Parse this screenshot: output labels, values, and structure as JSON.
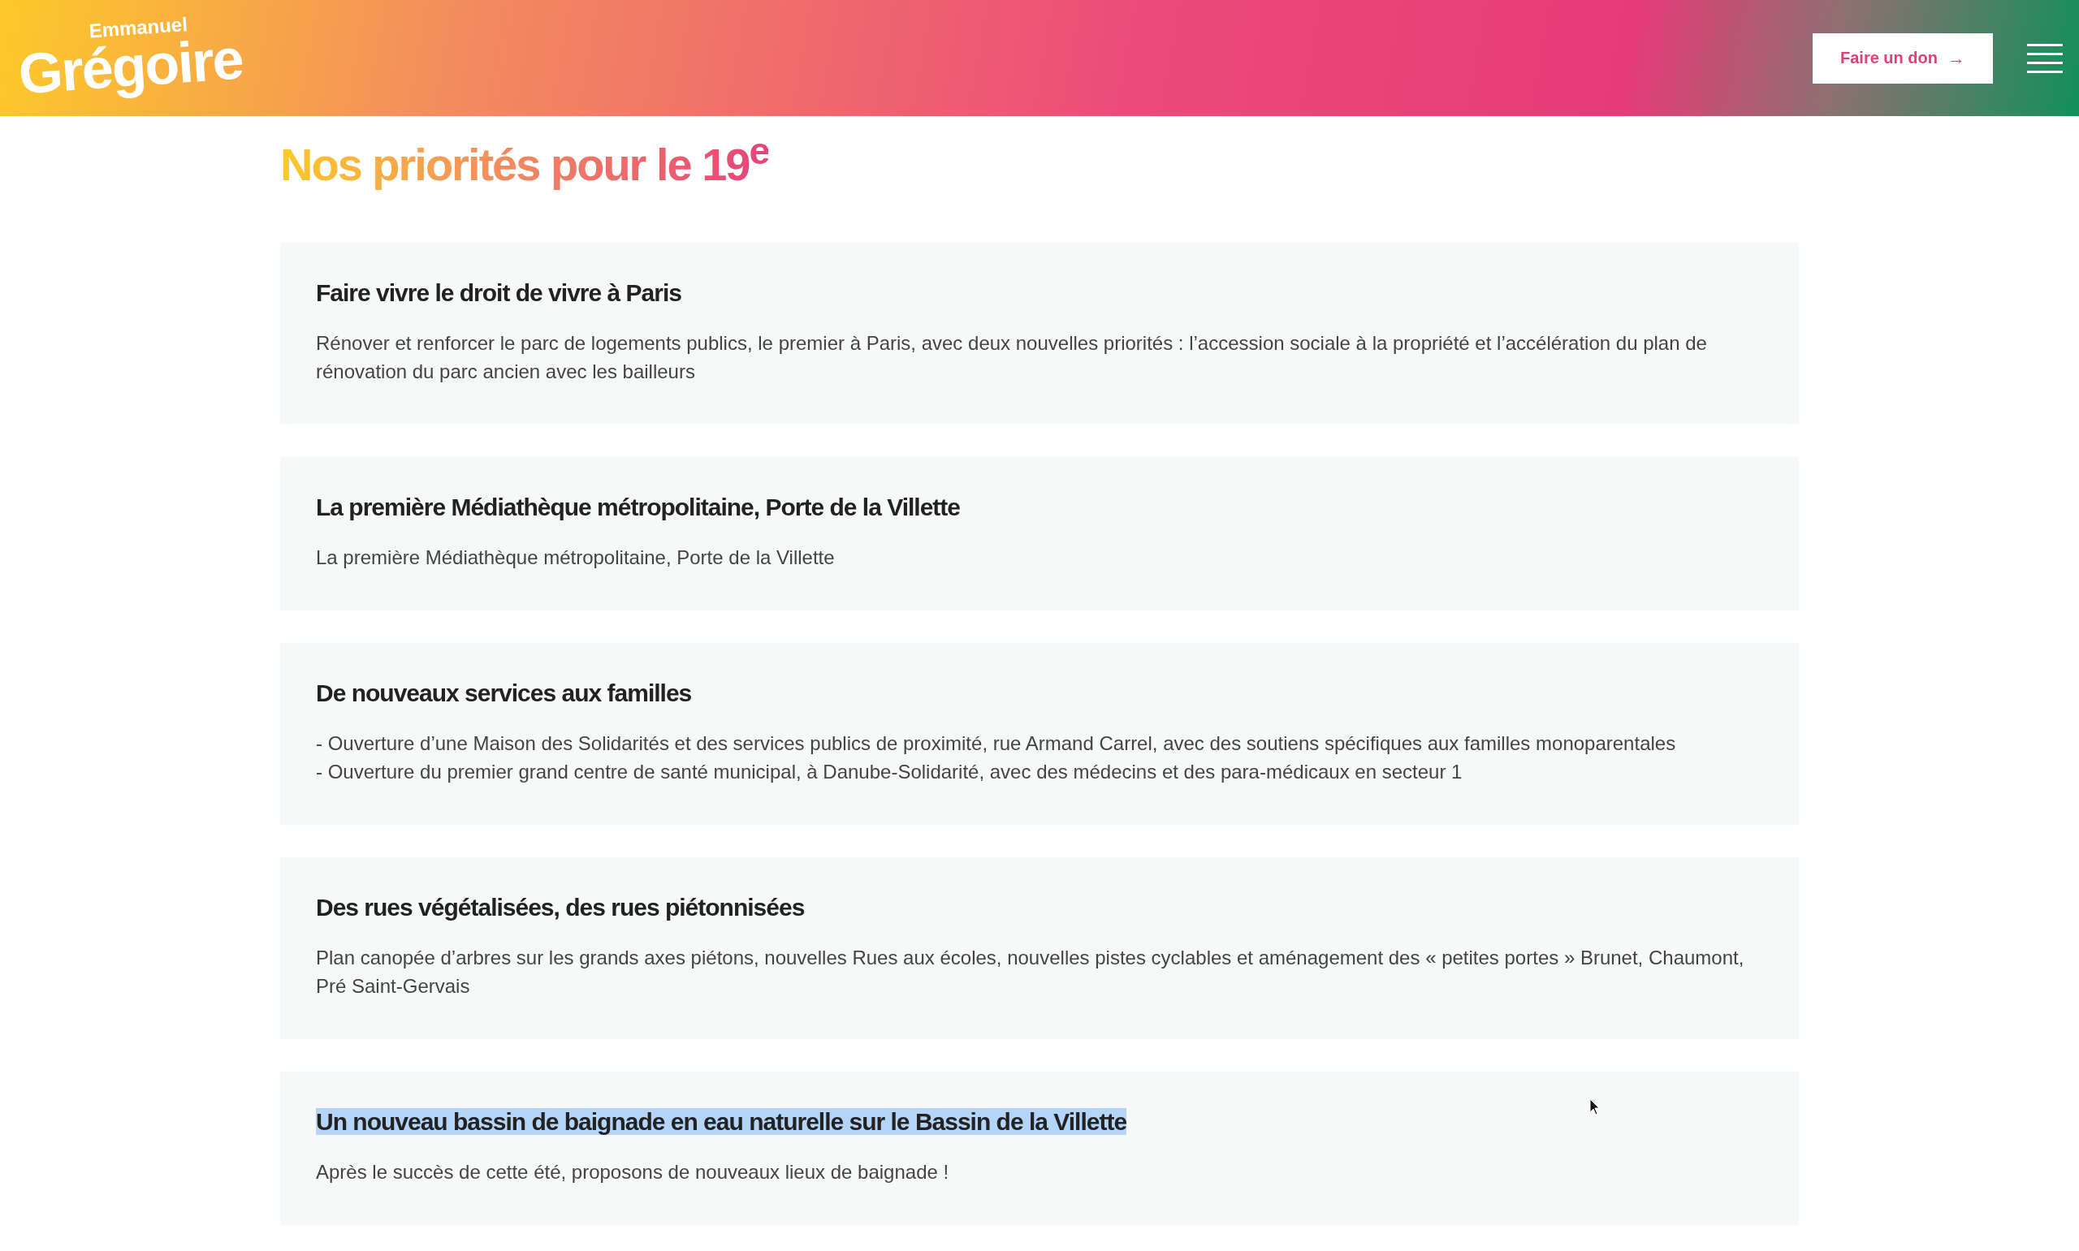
{
  "header": {
    "logo": {
      "first_name": "Emmanuel",
      "last_name": "Grégoire"
    },
    "donate_button": "Faire un don",
    "arrow": "→"
  },
  "page_title": "Nos priorités pour le 19$^{e}$",
  "priorities": [
    {
      "title": "Faire vivre le droit de vivre à Paris",
      "highlighted": false,
      "paragraphs": [
        "Rénover et renforcer le parc de logements publics, le premier à Paris, avec deux nouvelles priorités : l’accession sociale à la propriété et l’accélération du plan de rénovation du parc ancien avec les bailleurs"
      ]
    },
    {
      "title": "La première Médiathèque métropolitaine, Porte de la Villette",
      "highlighted": false,
      "paragraphs": [
        "La première Médiathèque métropolitaine, Porte de la Villette"
      ]
    },
    {
      "title": "De nouveaux services aux familles",
      "highlighted": false,
      "paragraphs": [
        "- Ouverture d’une Maison des Solidarités et des services publics de proximité, rue Armand Carrel, avec des soutiens spécifiques aux familles monoparentales",
        "- Ouverture du premier grand centre de santé municipal, à Danube-Solidarité, avec des médecins et des para-médicaux en secteur 1"
      ]
    },
    {
      "title": "Des rues végétalisées, des rues piétonnisées",
      "highlighted": false,
      "paragraphs": [
        "Plan canopée d’arbres sur les grands axes piétons, nouvelles Rues aux écoles, nouvelles pistes cyclables et aménagement des « petites portes » Brunet, Chaumont, Pré Saint-Gervais"
      ]
    },
    {
      "title": "Un nouveau bassin de baignade en eau naturelle sur le Bassin de la Villette",
      "highlighted": true,
      "paragraphs": [
        "Après le succès de cette été, proposons de nouveaux lieux de baignade !"
      ]
    }
  ]
}
